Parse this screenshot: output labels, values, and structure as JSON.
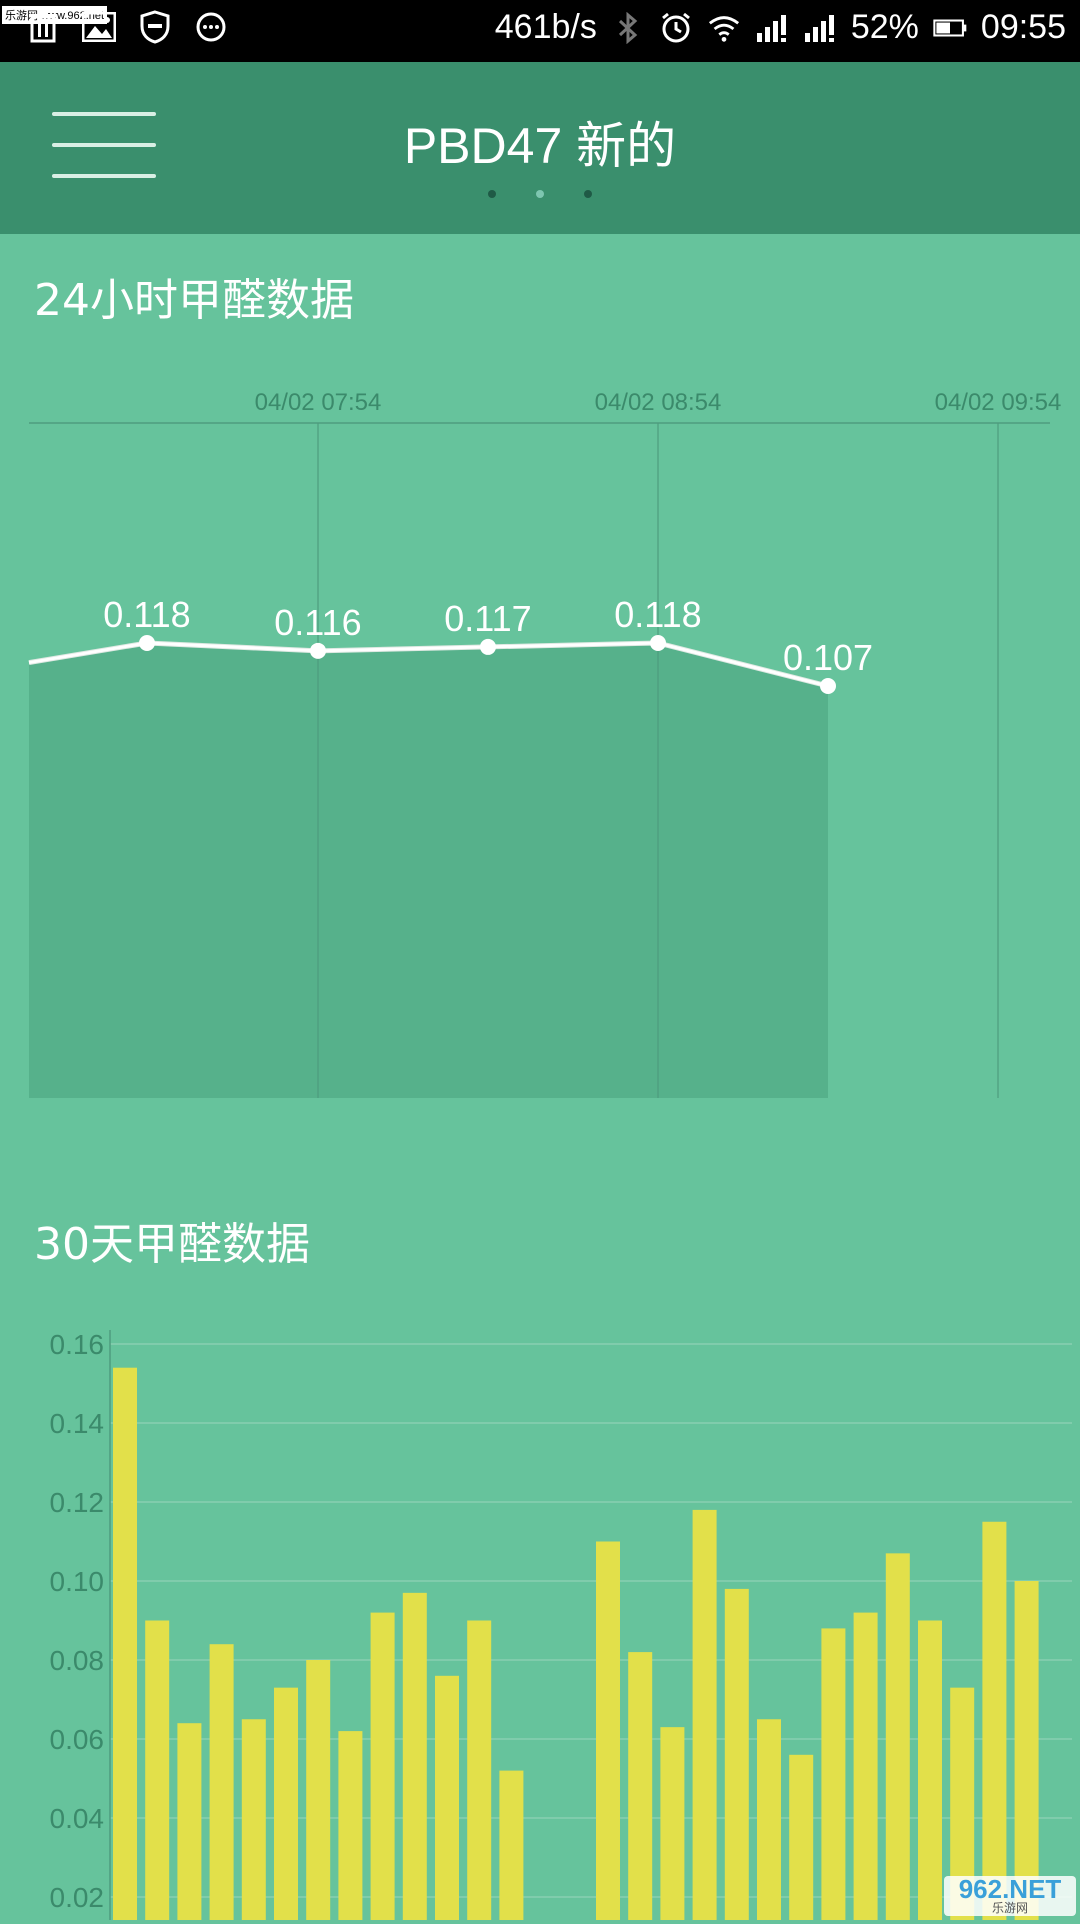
{
  "status_bar": {
    "left_watermark": "乐游网 www.962.net",
    "net_speed": "461b/s",
    "battery": "52%",
    "time": "09:55",
    "icons": [
      "trash-icon",
      "image-icon",
      "shield-icon",
      "more-icon",
      "bluetooth-icon",
      "alarm-icon",
      "wifi-icon",
      "signal-icon",
      "signal-icon",
      "battery-icon"
    ]
  },
  "header": {
    "title": "PBD47 新的",
    "menu_icon": "hamburger-icon",
    "page_count": 3,
    "active_page": 1
  },
  "section_24h": {
    "title": "24小时甲醛数据"
  },
  "section_30d": {
    "title": "30天甲醛数据"
  },
  "watermark": {
    "brand": "962.NET",
    "sub": "乐游网"
  },
  "colors": {
    "background": "#66c39c",
    "header": "#3a8f6d",
    "area_fill": "#56b18b",
    "bar": "#e2e04a",
    "line": "#ffffff"
  },
  "chart_data": [
    {
      "type": "area",
      "x_ticks": [
        "04/02 07:54",
        "04/02 08:54",
        "04/02 09:54"
      ],
      "points": [
        {
          "x": "04/02 07:33",
          "y": 0.113
        },
        {
          "x": "04/02 07:33",
          "y": 0.118,
          "label": "0.118"
        },
        {
          "x": "04/02 07:54",
          "y": 0.116,
          "label": "0.116"
        },
        {
          "x": "04/02 08:24",
          "y": 0.117,
          "label": "0.117"
        },
        {
          "x": "04/02 08:54",
          "y": 0.118,
          "label": "0.118"
        },
        {
          "x": "04/02 09:24",
          "y": 0.107,
          "label": "0.107"
        }
      ],
      "grid": true
    },
    {
      "type": "bar",
      "y_ticks": [
        "0.02",
        "0.04",
        "0.06",
        "0.08",
        "0.10",
        "0.12",
        "0.14",
        "0.16"
      ],
      "ylim": [
        0.0,
        0.16
      ],
      "values": [
        0.154,
        0.09,
        0.064,
        0.084,
        0.065,
        0.073,
        0.08,
        0.062,
        0.092,
        0.097,
        0.076,
        0.09,
        0.052,
        null,
        null,
        0.11,
        0.082,
        0.063,
        0.118,
        0.098,
        0.065,
        0.056,
        0.088,
        0.092,
        0.107,
        0.09,
        0.073,
        0.115,
        0.1
      ],
      "grid": true
    }
  ]
}
